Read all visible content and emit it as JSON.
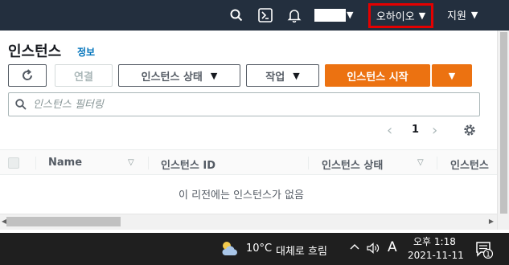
{
  "topbar": {
    "region_label": "오하이오",
    "support_label": "지원",
    "caret": "▼"
  },
  "page": {
    "title": "인스턴스",
    "info_link": "정보"
  },
  "toolbar": {
    "connect_label": "연결",
    "instance_state_label": "인스턴스 상태",
    "actions_label": "작업",
    "launch_label": "인스턴스 시작",
    "caret": "▼"
  },
  "search": {
    "placeholder": "인스턴스 필터링",
    "value": ""
  },
  "pagination": {
    "prev": "‹",
    "current_page": "1",
    "next": "›"
  },
  "table": {
    "columns": [
      {
        "label": "Name",
        "sortable": true
      },
      {
        "label": "인스턴스 ID",
        "sortable": false
      },
      {
        "label": "인스턴스 상태",
        "sortable": true
      },
      {
        "label": "인스턴스",
        "sortable": false
      }
    ],
    "empty_message": "이 리전에는 인스턴스가 없음"
  },
  "taskbar": {
    "temperature": "10°C",
    "weather": "대체로 흐림",
    "ime": "A",
    "time": "오후 1:18",
    "date": "2021-11-11",
    "notification_count": "1"
  },
  "colors": {
    "topbar_bg": "#232f3e",
    "primary": "#ec7211",
    "link": "#0073bb",
    "highlight_border": "#e40000",
    "taskbar_bg": "#1f1f1f"
  }
}
